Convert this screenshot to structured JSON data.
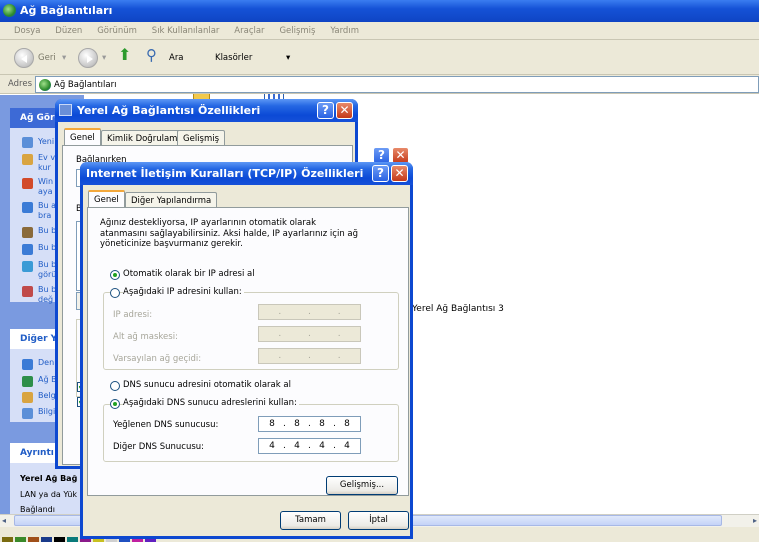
{
  "explorer": {
    "title": "Ağ Bağlantıları",
    "menu": [
      "Dosya",
      "Düzen",
      "Görünüm",
      "Sık Kullanılanlar",
      "Araçlar",
      "Gelişmiş",
      "Yardım"
    ],
    "toolbar": {
      "back": "Geri",
      "search": "Ara",
      "folders": "Klasörler"
    },
    "address_label": "Adres",
    "address_value": "Ağ Bağlantıları",
    "right_item": "Yerel Ağ Bağlantısı 3",
    "left": {
      "section1": "Ağ Görev",
      "links1": [
        "Yeni",
        "Ev v kur",
        "Win aya",
        "Bu a bra",
        "Bu b",
        "Bu b",
        "Bu b görü",
        "Bu b değ"
      ],
      "section2": "Diğer Y",
      "links2": [
        "Den",
        "Ağ B",
        "Belg",
        "Bilgi"
      ],
      "section3": "Ayrıntı",
      "details_title": "Yerel Ağ Bağ",
      "details_lines": [
        "LAN ya da Yük",
        "Bağlandı"
      ]
    }
  },
  "lan_dialog": {
    "title": "Yerel Ağ Bağlantısı Özellikleri",
    "tabs": [
      "Genel",
      "Kimlik Doğrulama",
      "Gelişmiş"
    ],
    "fragments": [
      "Bağlanırken",
      "B"
    ]
  },
  "tcp_dialog": {
    "title": "Internet İletişim Kuralları (TCP/IP) Özellikleri",
    "tabs": [
      "Genel",
      "Diğer Yapılandırma"
    ],
    "description": "Ağınız destekliyorsa, IP ayarlarının otomatik olarak atanmasını sağlayabilirsiniz. Aksi halde, IP ayarlarınız için ağ yöneticinize başvurmanız gerekir.",
    "ip_auto": "Otomatik olarak bir IP adresi al",
    "ip_manual": "Aşağıdaki IP adresini kullan:",
    "ip_address_label": "IP adresi:",
    "subnet_label": "Alt ağ maskesi:",
    "gateway_label": "Varsayılan ağ geçidi:",
    "dns_auto": "DNS sunucu adresini otomatik olarak al",
    "dns_manual": "Aşağıdaki DNS sunucu adreslerini kullan:",
    "dns_pref_label": "Yeğlenen DNS sunucusu:",
    "dns_alt_label": "Diğer DNS Sunucusu:",
    "dns_pref": [
      "8",
      "8",
      "8",
      "8"
    ],
    "dns_alt": [
      "4",
      "4",
      "4",
      "4"
    ],
    "advanced": "Gelişmiş...",
    "ok": "Tamam",
    "cancel": "İptal",
    "help_glyph": "?",
    "close_glyph": "✕"
  },
  "colors": {
    "accent": "#0b4ad6",
    "xp_face": "#ece9d8",
    "link": "#215dc6",
    "radio_dot": "#21a121"
  }
}
